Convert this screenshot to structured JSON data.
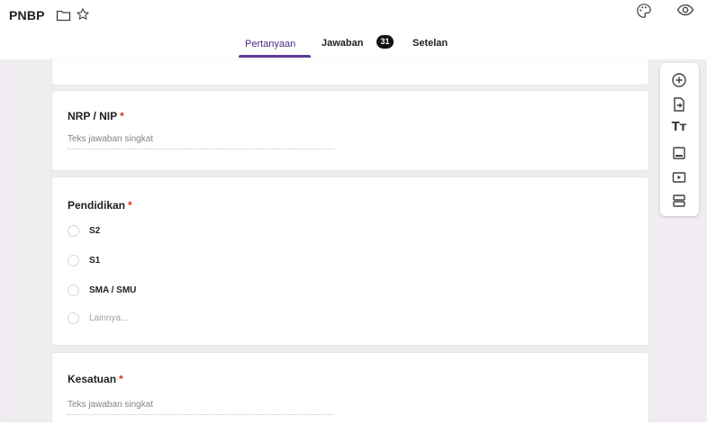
{
  "form": {
    "title": "PNBP",
    "icons": {
      "folder": "folder-icon",
      "star": "star-icon",
      "palette": "palette-icon",
      "preview": "eye-icon"
    }
  },
  "tabs": [
    {
      "label": "Pertanyaan",
      "active": true
    },
    {
      "label": "Jawaban",
      "badge": "31"
    },
    {
      "label": "Setelan"
    }
  ],
  "questions": [
    {
      "title": "NRP / NIP",
      "required_mark": "*",
      "placeholder": "Teks jawaban singkat"
    },
    {
      "title": "Pendidikan",
      "required_mark": "*",
      "options": [
        "S2",
        "S1",
        "SMA / SMU",
        "Lainnya..."
      ]
    },
    {
      "title": "Kesatuan",
      "required_mark": "*",
      "placeholder": "Teks jawaban singkat"
    }
  ],
  "toolbar": {
    "items": [
      "add-question-icon",
      "import-questions-icon",
      "add-title-icon",
      "add-image-icon",
      "add-video-icon",
      "add-section-icon"
    ],
    "title_glyph": "Tт"
  },
  "colors": {
    "accent": "#5b3a99",
    "required": "#d93025",
    "background": "#f0ecf2"
  }
}
